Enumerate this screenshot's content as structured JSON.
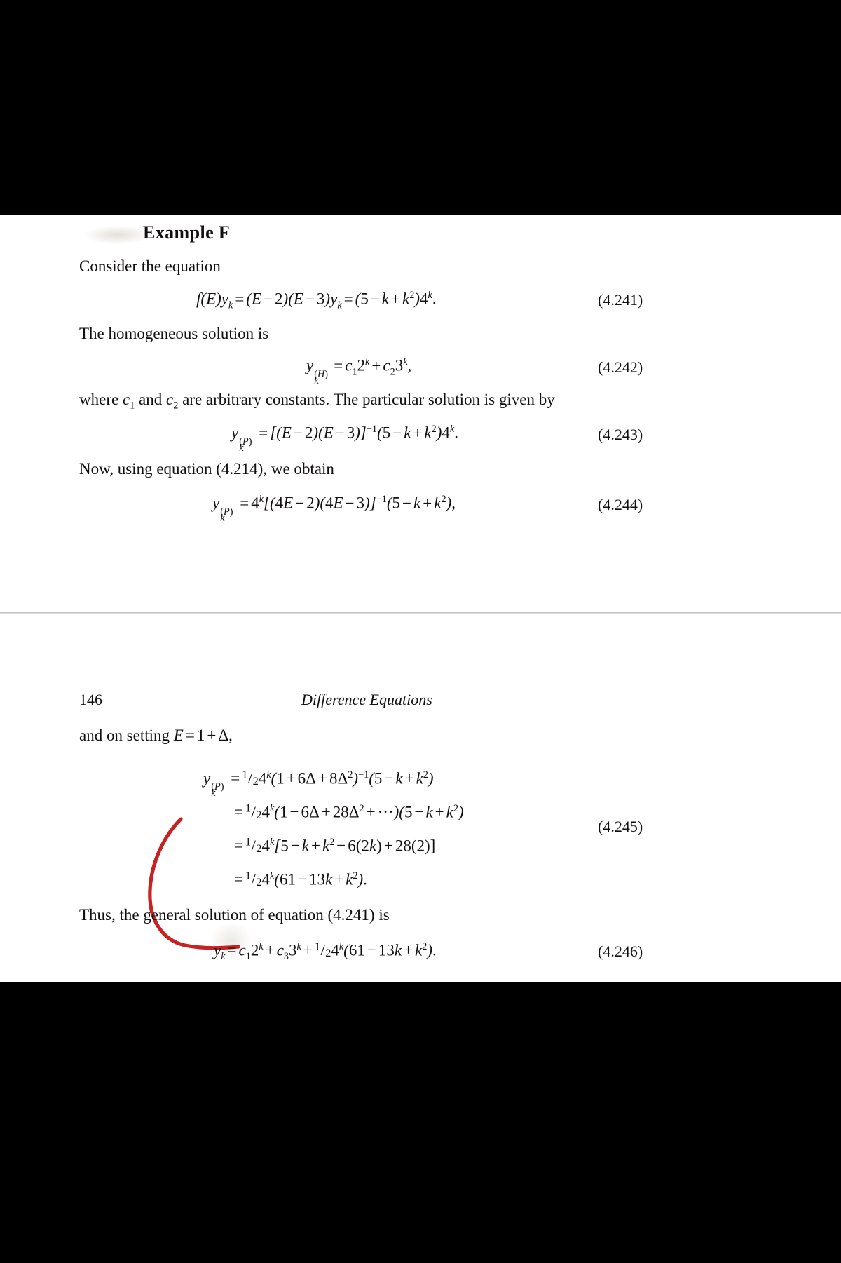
{
  "document": {
    "type": "scanned-textbook-page",
    "running_head": {
      "page_number": "146",
      "title": "Difference Equations"
    },
    "heading": "Example F",
    "paragraphs": {
      "p1": "Consider the equation",
      "p2": "The homogeneous solution is",
      "p3_a": "where ",
      "p3_c1": "c",
      "p3_c1_sub": "1",
      "p3_b": " and ",
      "p3_c2": "c",
      "p3_c2_sub": "2",
      "p3_c": " are arbitrary constants. The particular solution is given by",
      "p4": "Now, using equation (4.214), we obtain",
      "p5_a": "and on setting ",
      "p5_math": "E = 1 + Δ,",
      "p6": "Thus, the general solution of equation (4.241) is"
    },
    "equations": [
      {
        "id": "eq-4-241",
        "tag": "(4.241)",
        "latex": "f(E)y_k = (E - 2)(E - 3)y_k = (5 - k + k^2)4^k.",
        "plain": "f(E)yₖ = (E − 2)(E − 3)yₖ = (5 − k + k²)4ᵏ."
      },
      {
        "id": "eq-4-242",
        "tag": "(4.242)",
        "latex": "y_k^{(H)} = c_1 2^k + c_2 3^k,",
        "plain": "yₖ^(H) = c₁ 2ᵏ + c₂ 3ᵏ,"
      },
      {
        "id": "eq-4-243",
        "tag": "(4.243)",
        "latex": "y_k^{(P)} = [(E-2)(E-3)]^{-1}(5 - k + k^2)4^k.",
        "plain": "yₖ^(P) = [(E − 2)(E − 3)]⁻¹(5 − k + k²)4ᵏ."
      },
      {
        "id": "eq-4-244",
        "tag": "(4.244)",
        "latex": "y_k^{(P)} = 4^k[(4E-2)(4E-3)]^{-1}(5 - k + k^2),",
        "plain": "yₖ^(P) = 4ᵏ[(4E − 2)(4E − 3)]⁻¹(5 − k + k²),"
      },
      {
        "id": "eq-4-245",
        "tag": "(4.245)",
        "lines": [
          "y_k^{(P)} = 1/24 4^k (1 + 6Δ + 8Δ^2)^{-1}(5 - k + k^2)",
          "= 1/24 4^k (1 - 6Δ + 28Δ^2 + ⋯)(5 - k + k^2)",
          "= 1/24 4^k [5 - k + k^2 - 6(2k) + 28(2)]",
          "= 1/24 4^k (61 - 13k + k^2)."
        ]
      },
      {
        "id": "eq-4-246",
        "tag": "(4.246)",
        "latex": "y_k = c_1 2^k + c_3 3^k + 1/24\\,4^k(61 - 13k + k^2).",
        "plain": "yₖ = c₁ 2ᵏ + c₃ 3ᵏ + ½₄ 4ᵏ(61 − 13k + k²)."
      }
    ],
    "annotation": {
      "type": "handwritten-brace",
      "color": "#c62222",
      "description": "red hand-drawn curly brace bracketing equation 4.245"
    },
    "colors": {
      "letterbox": "#000000",
      "page_background": "#ffffff",
      "ink": "#12100e",
      "annotation_red": "#c62222",
      "divider": "#b9b9b9"
    }
  }
}
